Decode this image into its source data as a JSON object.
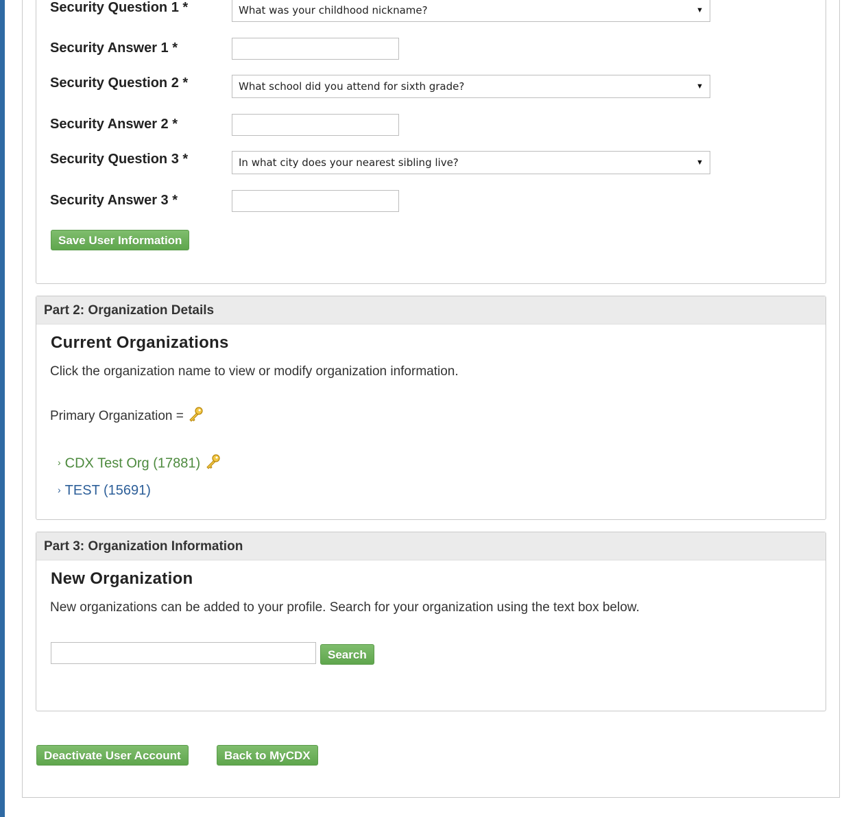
{
  "account": {
    "questions": [
      {
        "label": "Security Question 1 *",
        "selected": "What was your childhood nickname?"
      },
      {
        "label": "Security Question 2 *",
        "selected": "What school did you attend for sixth grade?"
      },
      {
        "label": "Security Question 3 *",
        "selected": "In what city does your nearest sibling live?"
      }
    ],
    "answers": [
      {
        "label": "Security Answer 1 *",
        "value": ""
      },
      {
        "label": "Security Answer 2 *",
        "value": ""
      },
      {
        "label": "Security Answer 3 *",
        "value": ""
      }
    ],
    "save_label": "Save User Information"
  },
  "part2": {
    "header": "Part 2: Organization Details",
    "heading": "Current Organizations",
    "instruction": "Click the organization name to view or modify organization information.",
    "primary_label": "Primary Organization =",
    "orgs": [
      {
        "name": "CDX Test Org (17881)",
        "primary": true
      },
      {
        "name": "TEST (15691)",
        "primary": false
      }
    ]
  },
  "part3": {
    "header": "Part 3: Organization Information",
    "heading": "New Organization",
    "instruction": "New organizations can be added to your profile. Search for your organization using the text box below.",
    "search_value": "",
    "search_label": "Search"
  },
  "footer": {
    "deactivate_label": "Deactivate User Account",
    "back_label": "Back to MyCDX"
  },
  "colors": {
    "accent_green": "#6aae58",
    "link_green": "#4d8a3e",
    "link_blue": "#2d5f99",
    "left_bar": "#2f6aa4"
  },
  "icons": {
    "primary_marker": "key-icon",
    "expand": "chevron-right-icon",
    "dropdown": "triangle-down-icon"
  }
}
